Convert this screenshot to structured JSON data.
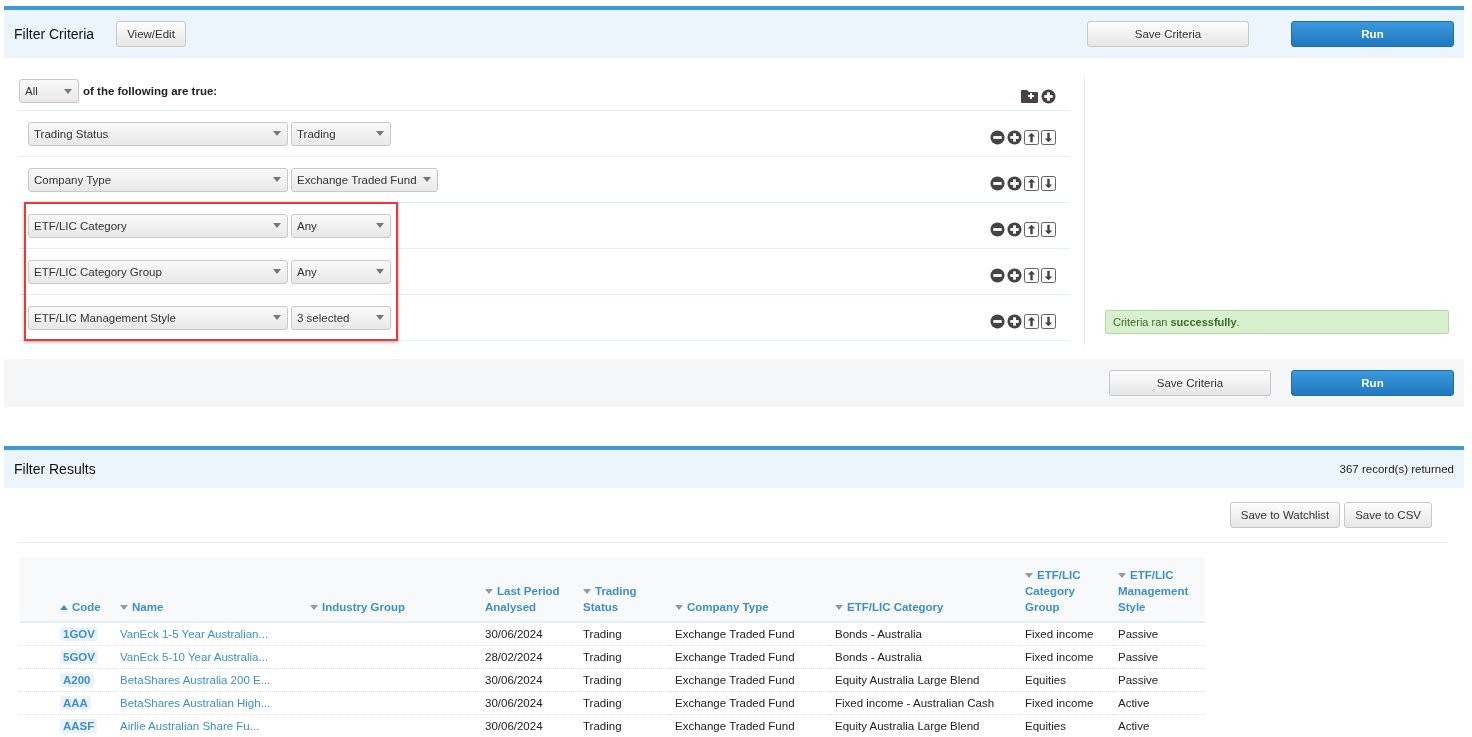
{
  "filter_criteria": {
    "title": "Filter Criteria",
    "view_edit_button": "View/Edit",
    "save_button": "Save Criteria",
    "run_button": "Run",
    "match_select": "All",
    "match_text": "of the following are true:",
    "criteria": [
      {
        "field": "Trading Status",
        "value": "Trading",
        "highlighted": false
      },
      {
        "field": "Company Type",
        "value": "Exchange Traded Fund",
        "highlighted": false
      },
      {
        "field": "ETF/LIC Category",
        "value": "Any",
        "highlighted": true
      },
      {
        "field": "ETF/LIC Category Group",
        "value": "Any",
        "highlighted": true
      },
      {
        "field": "ETF/LIC Management Style",
        "value": "3 selected",
        "highlighted": true
      }
    ],
    "status_message": "Criteria ran **successfully**.",
    "footer_save_button": "Save Criteria",
    "footer_run_button": "Run"
  },
  "filter_results": {
    "title": "Filter Results",
    "record_count": "367 record(s) returned",
    "buttons": [
      "Save to Watchlist",
      "Save to CSV"
    ],
    "table": {
      "columns": [
        {
          "label": "Code",
          "sorted": true
        },
        {
          "label": "Name",
          "sorted": false
        },
        {
          "label": "Industry Group",
          "sorted": false
        },
        {
          "label": "Last Period Analysed",
          "sorted": false
        },
        {
          "label": "Trading Status",
          "sorted": false
        },
        {
          "label": "Company Type",
          "sorted": false
        },
        {
          "label": "ETF/LIC Category",
          "sorted": false
        },
        {
          "label": "ETF/LIC Category Group",
          "sorted": false
        },
        {
          "label": "ETF/LIC Management Style",
          "sorted": false
        }
      ],
      "rows": [
        [
          "1GOV",
          "VanEck 1-5 Year Australian...",
          "",
          "30/06/2024",
          "Trading",
          "Exchange Traded Fund",
          "Bonds - Australia",
          "Fixed income",
          "Passive"
        ],
        [
          "5GOV",
          "VanEck 5-10 Year Australia...",
          "",
          "28/02/2024",
          "Trading",
          "Exchange Traded Fund",
          "Bonds - Australia",
          "Fixed income",
          "Passive"
        ],
        [
          "A200",
          "BetaShares Australia 200 E...",
          "",
          "30/06/2024",
          "Trading",
          "Exchange Traded Fund",
          "Equity Australia Large Blend",
          "Equities",
          "Passive"
        ],
        [
          "AAA",
          "BetaShares Australian High...",
          "",
          "30/06/2024",
          "Trading",
          "Exchange Traded Fund",
          "Fixed income - Australian Cash",
          "Fixed income",
          "Active"
        ],
        [
          "AASF",
          "Airlie Australian Share Fu...",
          "",
          "30/06/2024",
          "Trading",
          "Exchange Traded Fund",
          "Equity Australia Large Blend",
          "Equities",
          "Active"
        ]
      ]
    }
  }
}
